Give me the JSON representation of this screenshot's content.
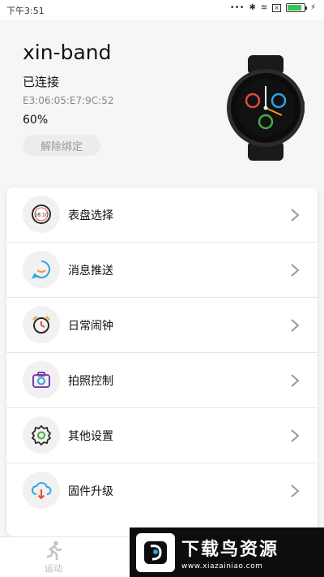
{
  "status_bar": {
    "time": "下午3:51",
    "dots": "•••",
    "bt": "✱",
    "wifi": "≋",
    "x": "×",
    "bolt": "⚡"
  },
  "device": {
    "name": "xin-band",
    "status": "已连接",
    "mac": "E3:06:05:E7:9C:52",
    "battery": "60%",
    "unbind_label": "解除绑定"
  },
  "menu": {
    "items": [
      {
        "label": "表盘选择",
        "icon": "watch-face-icon",
        "icon_text": "18:10"
      },
      {
        "label": "消息推送",
        "icon": "message-icon"
      },
      {
        "label": "日常闹钟",
        "icon": "alarm-clock-icon"
      },
      {
        "label": "拍照控制",
        "icon": "camera-icon"
      },
      {
        "label": "其他设置",
        "icon": "gear-icon"
      },
      {
        "label": "固件升级",
        "icon": "cloud-download-icon"
      }
    ]
  },
  "nav": {
    "items": [
      {
        "label": "运动",
        "icon": "running-icon"
      }
    ]
  },
  "watermark": {
    "title": "下载鸟资源",
    "url": "www.xiazainiao.com"
  },
  "colors": {
    "accent_blue": "#2aa6e0",
    "accent_red": "#e24b3b",
    "accent_orange": "#f09a2d",
    "accent_purple": "#7b3fb0",
    "accent_green": "#4aa84a",
    "battery_green": "#34c759"
  }
}
